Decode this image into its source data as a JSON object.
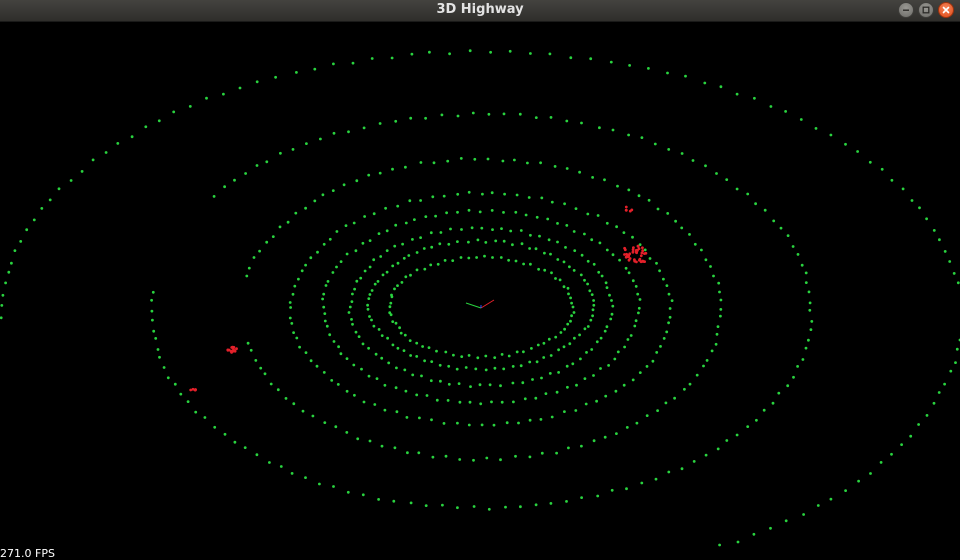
{
  "window": {
    "title": "3D Highway",
    "controls": {
      "minimize_icon": "minimize-icon",
      "maximize_icon": "maximize-icon",
      "close_icon": "close-icon"
    }
  },
  "viewer": {
    "fps_text": "271.0 FPS",
    "background_color": "#000000",
    "road_point_color": "#29d33f",
    "obstacle_point_color": "#e4202a",
    "axis_colors": {
      "x": "#e4202a",
      "y": "#29d33f",
      "z": "#2a4fff"
    }
  }
}
